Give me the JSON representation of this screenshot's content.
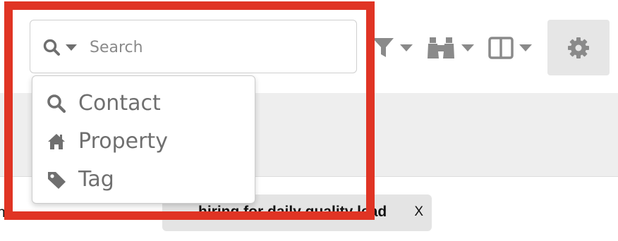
{
  "search": {
    "placeholder": "Search",
    "mode_icon": "search-icon"
  },
  "search_menu": {
    "items": [
      {
        "label": "Contact",
        "icon": "search-icon"
      },
      {
        "label": "Property",
        "icon": "home-icon"
      },
      {
        "label": "Tag",
        "icon": "tag-icon"
      }
    ]
  },
  "toolbar": {
    "icons": [
      "filter-icon",
      "binoculars-icon",
      "columns-icon",
      "gear-icon"
    ]
  },
  "tag_chip": {
    "text": "…hiring for daily quality lead",
    "close_label": "X"
  },
  "left_fragment": "n",
  "colors": {
    "highlight": "#e03424",
    "icon_gray": "#8a8a8a",
    "menu_text": "#6f6f6f",
    "settings_bg": "#e6e6e6",
    "band_bg": "#eeeeee",
    "chip_bg": "#e4e4e4"
  }
}
